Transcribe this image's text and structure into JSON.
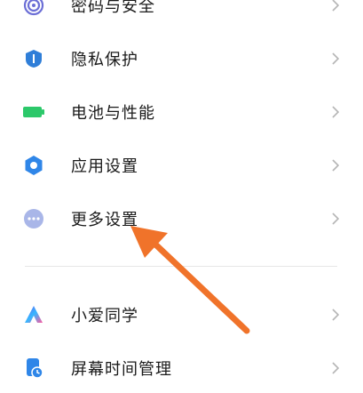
{
  "settings": {
    "items": [
      {
        "label": "密码与安全",
        "icon": "fingerprint-icon",
        "color": "#6c6fd6"
      },
      {
        "label": "隐私保护",
        "icon": "privacy-shield-icon",
        "color": "#2f7ed8"
      },
      {
        "label": "电池与性能",
        "icon": "battery-icon",
        "color": "#2cc86a"
      },
      {
        "label": "应用设置",
        "icon": "gear-icon",
        "color": "#2f86e8"
      },
      {
        "label": "更多设置",
        "icon": "more-dots-icon",
        "color": "#a9b6e8"
      }
    ],
    "items2": [
      {
        "label": "小爱同学",
        "icon": "xiaoai-icon",
        "color": "#3b8af0"
      },
      {
        "label": "屏幕时间管理",
        "icon": "screen-time-icon",
        "color": "#2f86e8"
      }
    ]
  },
  "annotation": {
    "arrow_color": "#f0732a"
  }
}
